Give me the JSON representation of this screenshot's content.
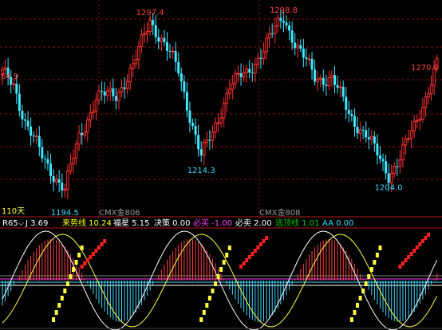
{
  "chart_data": [
    {
      "type": "candlestick",
      "price_range": [
        1185,
        1305
      ],
      "count": 110,
      "anchors": [
        [
          0,
          1265
        ],
        [
          2,
          1264.9
        ],
        [
          3,
          1262
        ],
        [
          5,
          1252
        ],
        [
          7,
          1238
        ],
        [
          9,
          1232
        ],
        [
          11,
          1228
        ],
        [
          13,
          1222
        ],
        [
          14,
          1212
        ],
        [
          15,
          1206
        ],
        [
          17,
          1199
        ],
        [
          19,
          1202
        ],
        [
          21,
          1197
        ],
        [
          22,
          1194.5
        ],
        [
          23,
          1198
        ],
        [
          25,
          1212
        ],
        [
          27,
          1228
        ],
        [
          29,
          1241
        ],
        [
          31,
          1246
        ],
        [
          33,
          1251
        ],
        [
          35,
          1256
        ],
        [
          37,
          1254
        ],
        [
          39,
          1250
        ],
        [
          41,
          1257
        ],
        [
          43,
          1259
        ],
        [
          45,
          1266
        ],
        [
          47,
          1277
        ],
        [
          49,
          1287
        ],
        [
          51,
          1292
        ],
        [
          52,
          1297.4
        ],
        [
          53,
          1292
        ],
        [
          55,
          1288
        ],
        [
          57,
          1280
        ],
        [
          59,
          1272
        ],
        [
          61,
          1268
        ],
        [
          63,
          1258
        ],
        [
          65,
          1246
        ],
        [
          67,
          1232
        ],
        [
          68,
          1219
        ],
        [
          70,
          1214.3
        ],
        [
          72,
          1220
        ],
        [
          74,
          1228
        ],
        [
          76,
          1240
        ],
        [
          78,
          1252
        ],
        [
          80,
          1262
        ],
        [
          82,
          1266
        ],
        [
          84,
          1264
        ],
        [
          86,
          1262
        ],
        [
          88,
          1267
        ],
        [
          90,
          1272
        ],
        [
          92,
          1280
        ],
        [
          94,
          1285
        ],
        [
          96,
          1289
        ],
        [
          98,
          1293
        ],
        [
          99,
          1298.8
        ],
        [
          100,
          1291
        ],
        [
          102,
          1286
        ],
        [
          104,
          1279
        ],
        [
          106,
          1272
        ],
        [
          108,
          1264
        ],
        [
          109,
          1258
        ]
      ],
      "extra_anchors_note": "",
      "annotations": [
        {
          "text": "1297.4",
          "index": 52,
          "value": 1297.4,
          "color": "#ff4040"
        },
        {
          "text": "1298.8",
          "index": 99,
          "value": 1298.8,
          "color": "#ff4040"
        },
        {
          "text": "1214.3",
          "index": 70,
          "value": 1214.3,
          "color": "#3fd8ff"
        },
        {
          "text": "1204.0",
          "index": 136,
          "value": 1204.0,
          "color": "#3fd8ff"
        },
        {
          "text": "1194.5",
          "index": 22,
          "value": 1194.5,
          "color": "#3fd8ff"
        },
        {
          "text": "1270.0",
          "index": 153,
          "value": 1270.0,
          "color": "#ff4040"
        },
        {
          "text": "64.9",
          "index": 2,
          "value": 1264.9,
          "color": "#ff4040"
        }
      ],
      "period_label": "110天",
      "contract_labels": [
        "CMX金806",
        "CMX金808"
      ]
    },
    {
      "type": "indicator",
      "params_label": "R65",
      "legend": [
        {
          "name": "J",
          "value": "3.69",
          "color": "#ffffff"
        },
        {
          "name": "来势线",
          "value": "10.24",
          "color": "#ffff00"
        },
        {
          "name": "福星",
          "value": "5.15",
          "color": "#ffffff"
        },
        {
          "name": "决策",
          "value": "0.00",
          "color": "#ffffff"
        },
        {
          "name": "必买",
          "value": "-1.00",
          "color": "#ff40ff"
        },
        {
          "name": "必卖",
          "value": "2.00",
          "color": "#ffffff"
        },
        {
          "name": "逃顶线",
          "value": "1.01",
          "color": "#00c000"
        },
        {
          "name": "AA",
          "value": "0.00",
          "color": "#3fd8ff"
        }
      ]
    }
  ],
  "ui": {
    "period": "110天",
    "contract_a": "CMX金806",
    "contract_b": "CMX金808",
    "params": "R65",
    "chevron": "⌵"
  }
}
